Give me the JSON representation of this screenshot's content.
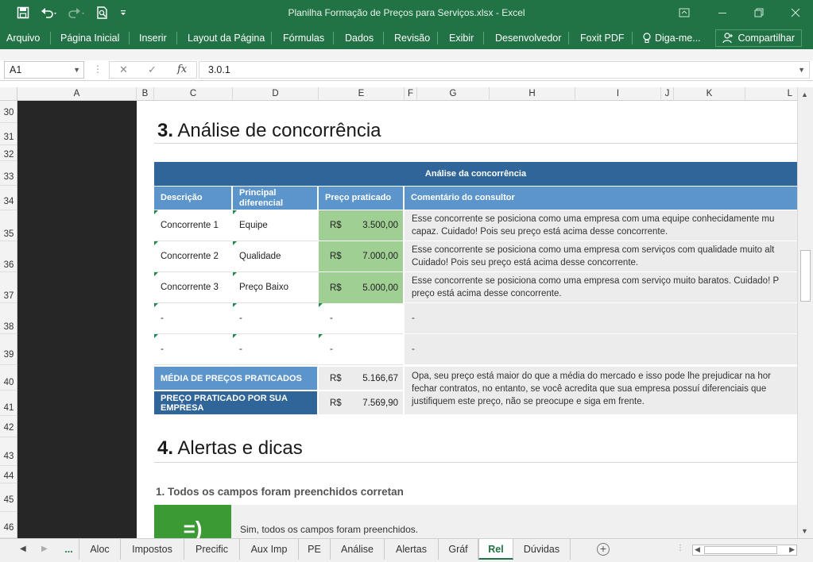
{
  "window": {
    "title": "Planilha Formação de Preços para Serviços.xlsx - Excel",
    "icons": [
      "save-icon",
      "undo-icon",
      "redo-icon",
      "print-preview-icon",
      "customize-icon",
      "ribbon-display-icon",
      "minimize-icon",
      "restore-icon",
      "close-icon"
    ]
  },
  "ribbon": {
    "tabs": [
      "Arquivo",
      "Página Inicial",
      "Inserir",
      "Layout da Página",
      "Fórmulas",
      "Dados",
      "Revisão",
      "Exibir",
      "Desenvolvedor",
      "Foxit PDF",
      "Diga-me..."
    ],
    "share": "Compartilhar"
  },
  "formula_bar": {
    "name_box": "A1",
    "formula": "3.0.1"
  },
  "columns": [
    "A",
    "B",
    "C",
    "D",
    "E",
    "F",
    "G",
    "H",
    "I",
    "J",
    "K",
    "L"
  ],
  "rows": [
    "30",
    "31",
    "32",
    "33",
    "34",
    "35",
    "36",
    "37",
    "38",
    "39",
    "40",
    "41",
    "42",
    "43",
    "44",
    "45",
    "46"
  ],
  "section3": {
    "number": "3.",
    "title": "Análise de concorrência",
    "table_title": "Análise da concorrência",
    "headers": [
      "Descrição",
      "Principal diferencial",
      "Preço praticado",
      "Comentário do consultor"
    ],
    "rows": [
      {
        "desc": "Concorrente 1",
        "diff": "Equipe",
        "cur": "R$",
        "price": "3.500,00",
        "comment": [
          "Esse concorrente se posiciona como uma empresa com uma equipe conhecidamente mu",
          "capaz. Cuidado! Pois seu preço está acima desse concorrente."
        ]
      },
      {
        "desc": "Concorrente 2",
        "diff": "Qualidade",
        "cur": "R$",
        "price": "7.000,00",
        "comment": [
          "Esse concorrente se posiciona como uma empresa com serviços com qualidade muito alt",
          "Cuidado! Pois seu preço está acima desse concorrente."
        ]
      },
      {
        "desc": "Concorrente 3",
        "diff": "Preço Baixo",
        "cur": "R$",
        "price": "5.000,00",
        "comment": [
          "Esse concorrente se posiciona como uma empresa com serviço muito baratos. Cuidado! P",
          "preço está acima desse concorrente."
        ]
      },
      {
        "desc": "-",
        "diff": "-",
        "cur": "",
        "price": "-",
        "comment": [
          "-",
          ""
        ]
      },
      {
        "desc": "-",
        "diff": "-",
        "cur": "",
        "price": "-",
        "comment": [
          "-",
          ""
        ]
      }
    ],
    "avg_label": "MÉDIA DE PREÇOS PRATICADOS",
    "avg_cur": "R$",
    "avg_value": "5.166,67",
    "own_label": "PREÇO PRATICADO POR SUA EMPRESA",
    "own_cur": "R$",
    "own_value": "7.569,90",
    "summary_comment": [
      "Opa, seu preço está maior do que a média do mercado e isso pode lhe prejudicar na hor",
      "fechar contratos, no entanto, se você acredita que sua empresa possuí diferenciais que",
      "justifiquem este preço, não se preocupe e siga em frente."
    ]
  },
  "section4": {
    "number": "4.",
    "title": "Alertas e dicas",
    "tip1_title": "1. Todos os campos foram preenchidos corretan",
    "tip1_icon": "=)",
    "tip1_text": "Sim, todos os campos foram preenchidos."
  },
  "sheet_tabs": {
    "ellipsis": "...",
    "tabs": [
      "Aloc",
      "Impostos",
      "Precific",
      "Aux Imp",
      "PE",
      "Análise",
      "Alertas",
      "Gráf",
      "Rel",
      "Dúvidas"
    ],
    "active": "Rel"
  },
  "colors": {
    "excel_green": "#217346",
    "header_dark_blue": "#2f6599",
    "header_blue": "#5b95cc",
    "price_green": "#9fcf93",
    "tip_green": "#3c9a35"
  }
}
